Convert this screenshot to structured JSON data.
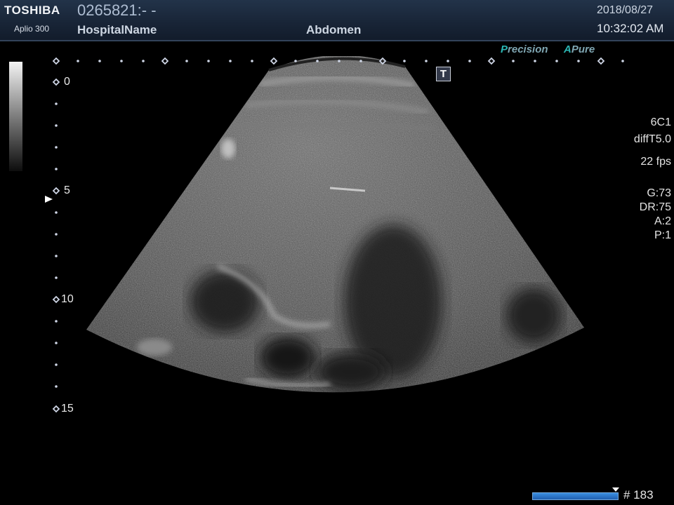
{
  "header": {
    "brand": "TOSHIBA",
    "model": "Aplio 300",
    "patient_id": "0265821:- -",
    "hospital": "HospitalName",
    "preset": "Abdomen",
    "date": "2018/08/27",
    "time": "10:32:02 AM"
  },
  "imaging_mode": {
    "precision_prefix": "P",
    "precision_rest": "recision",
    "pure_prefix": "A",
    "pure_rest": "Pure"
  },
  "transducer_marker": "T",
  "depth_scale": [
    "0",
    "5",
    "10",
    "15"
  ],
  "parameters": {
    "probe": "6C1",
    "harmonic": "diffT5.0",
    "frame_rate": "22 fps",
    "gain": "G:73",
    "dynamic_range": "DR:75",
    "a": "A:2",
    "p": "P:1"
  },
  "cine": {
    "frame_label": "# 183",
    "position": 1.0
  },
  "colors": {
    "header_bg": "#1b2638",
    "accent_teal": "#2bb6b3",
    "cine_bar": "#2a75cc"
  }
}
